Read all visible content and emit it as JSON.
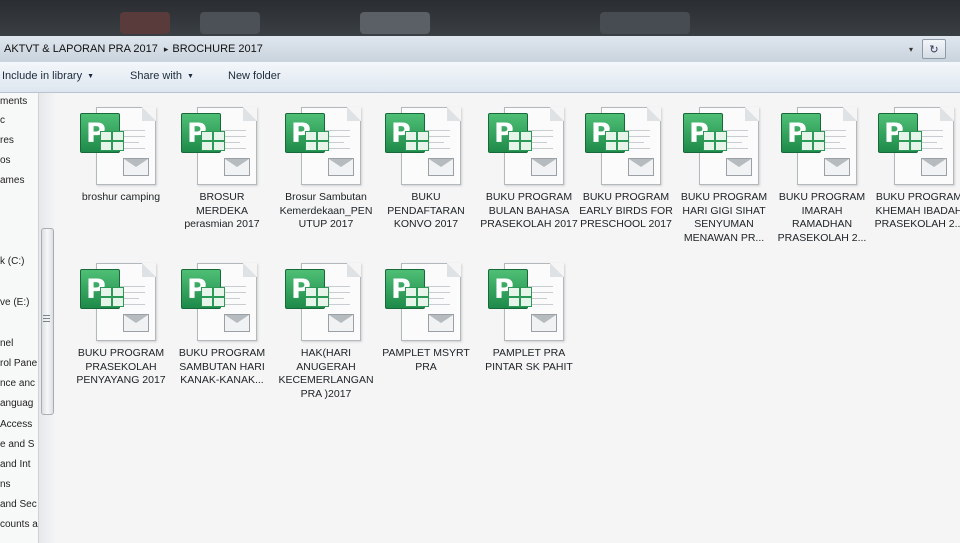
{
  "address": {
    "crumbs": [
      "AKTVT & LAPORAN PRA 2017",
      "BROCHURE 2017"
    ],
    "separator": "▸",
    "dropdown_glyph": "▾",
    "refresh_glyph": "↻"
  },
  "toolbar": {
    "include_in_library": "Include in library",
    "share_with": "Share with",
    "new_folder": "New folder",
    "caret": "▼"
  },
  "nav": {
    "items": [
      "ments",
      "c",
      "res",
      "os",
      "ames",
      "k (C:)",
      "ve (E:)",
      "nel",
      "rol Pane",
      "nce anc",
      "anguag",
      "Access",
      "e and S",
      "and Int",
      "ns",
      "and Sec",
      "counts a"
    ]
  },
  "files": [
    {
      "name": "broshur camping"
    },
    {
      "name": "BROSUR MERDEKA perasmian 2017"
    },
    {
      "name": "Brosur Sambutan Kemerdekaan_PENUTUP 2017"
    },
    {
      "name": "BUKU PENDAFTARAN KONVO 2017"
    },
    {
      "name": "BUKU PROGRAM BULAN BAHASA PRASEKOLAH 2017"
    },
    {
      "name": "BUKU PROGRAM EARLY BIRDS FOR PRESCHOOL 2017"
    },
    {
      "name": "BUKU PROGRAM HARI GIGI SIHAT SENYUMAN MENAWAN PR..."
    },
    {
      "name": "BUKU PROGRAM IMARAH RAMADHAN PRASEKOLAH 2..."
    },
    {
      "name": "BUKU PROGRAM KHEMAH IBADAH PRASEKOLAH 2..."
    },
    {
      "name": "BUKU PROGRAM PRASEKOLAH PENYAYANG 2017"
    },
    {
      "name": "BUKU PROGRAM SAMBUTAN HARI KANAK-KANAK..."
    },
    {
      "name": "HAK(HARI ANUGERAH KECEMERLANGAN PRA )2017"
    },
    {
      "name": "PAMPLET MSYRT PRA"
    },
    {
      "name": "PAMPLET PRA PINTAR SK PAHIT"
    }
  ],
  "icon": {
    "letter": "P",
    "name": "publisher-file-icon",
    "color": "#1e8a4a"
  }
}
